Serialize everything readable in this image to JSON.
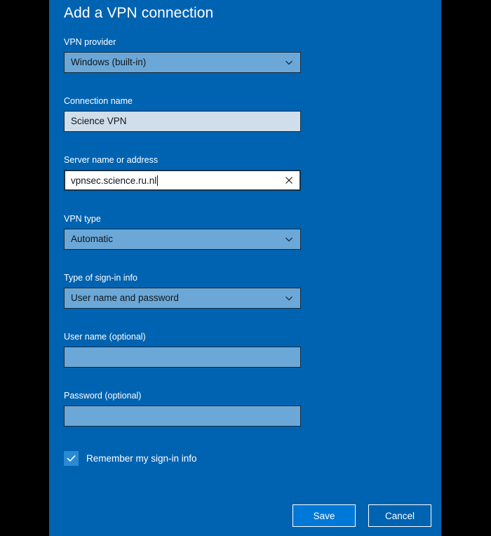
{
  "dialog": {
    "title": "Add a VPN connection"
  },
  "fields": {
    "vpn_provider": {
      "label": "VPN provider",
      "value": "Windows (built-in)",
      "type": "dropdown",
      "icon": "chevron-down-icon"
    },
    "connection_name": {
      "label": "Connection name",
      "value": "Science VPN",
      "type": "textbox"
    },
    "server_address": {
      "label": "Server name or address",
      "value": "vpnsec.science.ru.nl",
      "type": "textbox",
      "focused": true,
      "clear_icon": "clear-x-icon"
    },
    "vpn_type": {
      "label": "VPN type",
      "value": "Automatic",
      "type": "dropdown",
      "icon": "chevron-down-icon"
    },
    "signin_type": {
      "label": "Type of sign-in info",
      "value": "User name and password",
      "type": "dropdown",
      "icon": "chevron-down-icon"
    },
    "user_name": {
      "label": "User name (optional)",
      "value": "",
      "type": "textbox"
    },
    "password": {
      "label": "Password (optional)",
      "value": "",
      "type": "textbox"
    }
  },
  "checkbox": {
    "label": "Remember my sign-in info",
    "checked": true,
    "icon": "checkmark-icon"
  },
  "buttons": {
    "save": "Save",
    "cancel": "Cancel"
  },
  "colors": {
    "panel_background": "#0063b1",
    "screen_background": "#000000",
    "dropdown_fill": "#6ba8d8",
    "textbox_filled": "#cfdeea",
    "textbox_focused": "#ffffff",
    "control_border": "#122a3d",
    "accent_checkbox": "#2a8ad4",
    "save_button": "#0078d7",
    "text_light": "#ffffff",
    "text_dark": "#11171c"
  }
}
